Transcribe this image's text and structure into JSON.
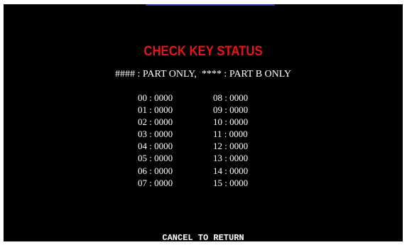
{
  "title": "CHECK KEY STATUS",
  "legend": "#### : PART ONLY,  **** : PART B ONLY",
  "keys_left": [
    {
      "id": "00",
      "value": "0000"
    },
    {
      "id": "01",
      "value": "0000"
    },
    {
      "id": "02",
      "value": "0000"
    },
    {
      "id": "03",
      "value": "0000"
    },
    {
      "id": "04",
      "value": "0000"
    },
    {
      "id": "05",
      "value": "0000"
    },
    {
      "id": "06",
      "value": "0000"
    },
    {
      "id": "07",
      "value": "0000"
    }
  ],
  "keys_right": [
    {
      "id": "08",
      "value": "0000"
    },
    {
      "id": "09",
      "value": "0000"
    },
    {
      "id": "10",
      "value": "0000"
    },
    {
      "id": "11",
      "value": "0000"
    },
    {
      "id": "12",
      "value": "0000"
    },
    {
      "id": "13",
      "value": "0000"
    },
    {
      "id": "14",
      "value": "0000"
    },
    {
      "id": "15",
      "value": "0000"
    }
  ],
  "footer": "CANCEL TO RETURN",
  "colors": {
    "background": "#000000",
    "title": "#e8141a",
    "text": "#ffffff",
    "border": "#ffffff",
    "accent": "#26349c"
  }
}
